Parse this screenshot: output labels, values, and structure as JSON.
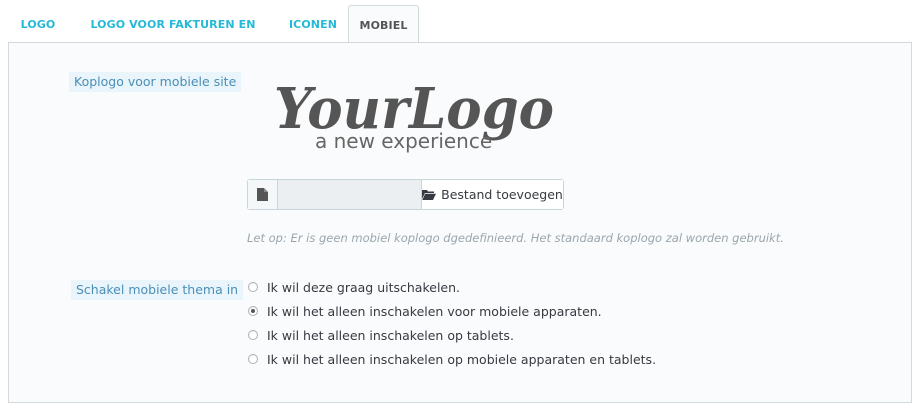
{
  "tabs": [
    {
      "label": "LOGO",
      "active": false
    },
    {
      "label": "LOGO VOOR FAKTUREN EN EMAILS",
      "active": false
    },
    {
      "label": "ICONEN",
      "active": false
    },
    {
      "label": "MOBIEL",
      "active": true
    }
  ],
  "mobile_logo": {
    "label": "Koplogo voor mobiele site",
    "logo_text": "YourLogo",
    "logo_tagline": "a new experience",
    "file_input_value": "",
    "add_file_label": "Bestand toevoegen",
    "help_text": "Let op: Er is geen mobiel koplogo dgedefinieerd. Het standaard koplogo zal worden gebruikt."
  },
  "mobile_theme": {
    "label": "Schakel mobiele thema in",
    "options": [
      {
        "label": "Ik wil deze graag uitschakelen.",
        "checked": false
      },
      {
        "label": "Ik wil het alleen inschakelen voor mobiele apparaten.",
        "checked": true
      },
      {
        "label": "Ik wil het alleen inschakelen op tablets.",
        "checked": false
      },
      {
        "label": "Ik wil het alleen inschakelen op mobiele apparaten en tablets.",
        "checked": false
      }
    ]
  },
  "colors": {
    "accent": "#25b9d7",
    "label_bg": "#e9f5fb",
    "label_text": "#4a8fb7"
  }
}
